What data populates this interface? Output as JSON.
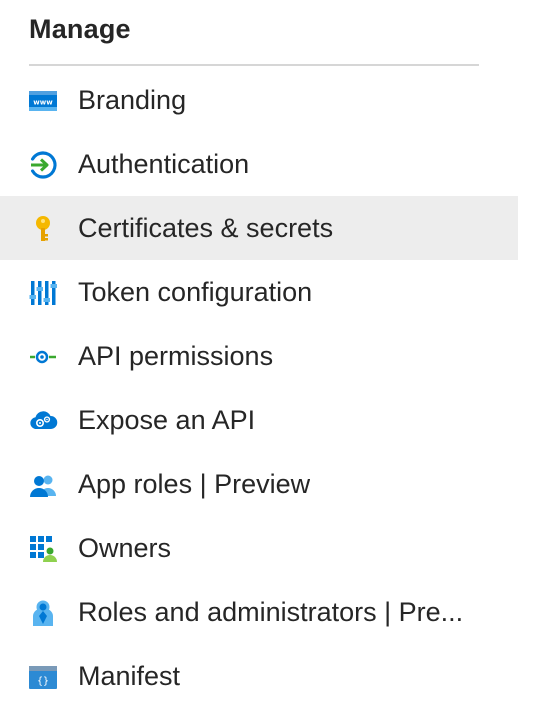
{
  "section": {
    "title": "Manage"
  },
  "nav": {
    "items": [
      {
        "label": "Branding",
        "icon": "branding-icon",
        "selected": false
      },
      {
        "label": "Authentication",
        "icon": "authentication-icon",
        "selected": false
      },
      {
        "label": "Certificates & secrets",
        "icon": "key-icon",
        "selected": true
      },
      {
        "label": "Token configuration",
        "icon": "token-configuration-icon",
        "selected": false
      },
      {
        "label": "API permissions",
        "icon": "api-permissions-icon",
        "selected": false
      },
      {
        "label": "Expose an API",
        "icon": "cloud-gear-icon",
        "selected": false
      },
      {
        "label": "App roles | Preview",
        "icon": "app-roles-icon",
        "selected": false
      },
      {
        "label": "Owners",
        "icon": "owners-icon",
        "selected": false
      },
      {
        "label": "Roles and administrators | Pre...",
        "icon": "roles-administrators-icon",
        "selected": false
      },
      {
        "label": "Manifest",
        "icon": "manifest-icon",
        "selected": false
      }
    ]
  },
  "colors": {
    "selected_background": "#ededed",
    "divider": "#d6d6d6",
    "text": "#262626",
    "azure_blue": "#0078d4",
    "key_yellow": "#f5b800",
    "green": "#3aa82f"
  }
}
